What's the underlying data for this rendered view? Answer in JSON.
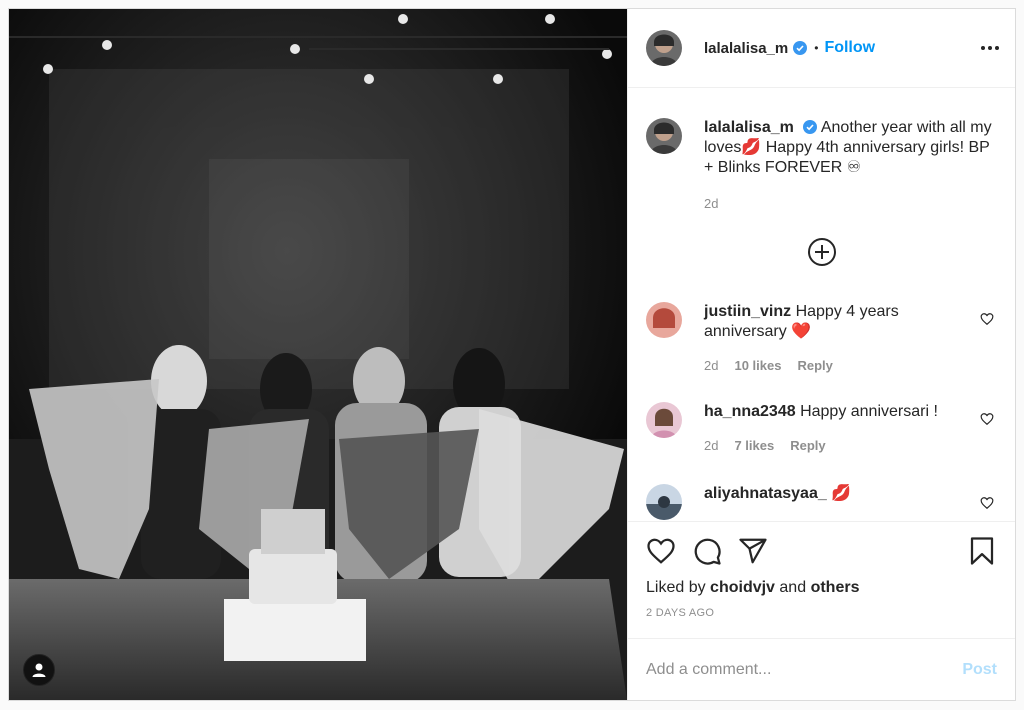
{
  "post": {
    "author": {
      "username": "lalalalisa_m",
      "verified": true,
      "follow_label": "Follow",
      "dot": "•"
    },
    "caption": {
      "username": "lalalalisa_m",
      "text": "Another year with all my loves💋 Happy 4th anniversary girls! BP + Blinks FOREVER ♾",
      "age": "2d"
    },
    "comments": [
      {
        "username": "justiin_vinz",
        "text": "Happy 4 years anniversary ❤️",
        "age": "2d",
        "likes": "10 likes",
        "reply": "Reply"
      },
      {
        "username": "ha_nna2348",
        "text": "Happy anniversari !",
        "age": "2d",
        "likes": "7 likes",
        "reply": "Reply"
      },
      {
        "username": "aliyahnatasyaa_",
        "text": "💋",
        "age": "",
        "likes": "",
        "reply": ""
      }
    ],
    "liked_by": {
      "prefix": "Liked by",
      "user": "choidvjv",
      "and": "and",
      "others": "others"
    },
    "timestamp": "2 DAYS AGO",
    "add_comment": {
      "placeholder": "Add a comment...",
      "post_label": "Post"
    }
  },
  "colors": {
    "accent": "#0095f6",
    "verified": "#3897f0",
    "heart": "#ed4956",
    "post_disabled": "#b2dffc",
    "muted": "#8e8e8e"
  },
  "icons": {
    "header": [
      "avatar",
      "verified-icon",
      "more-icon"
    ],
    "actions": [
      "heart-icon",
      "comment-icon",
      "share-icon",
      "bookmark-icon"
    ],
    "photo": [
      "user-tag-icon"
    ]
  }
}
